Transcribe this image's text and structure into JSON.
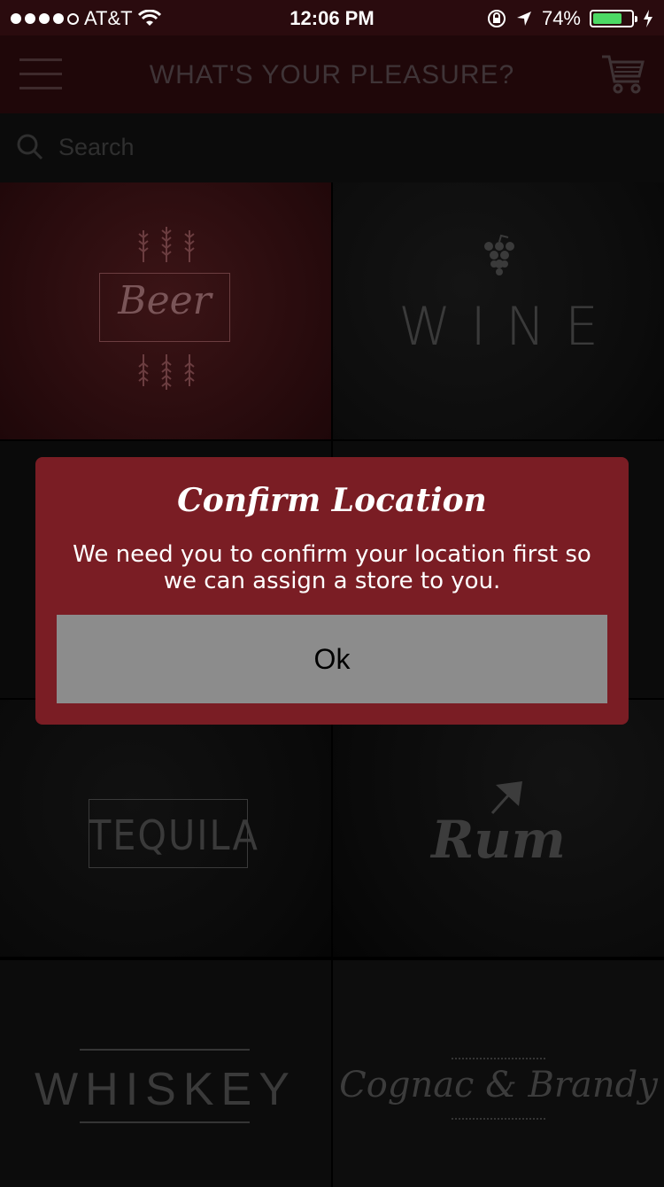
{
  "status_bar": {
    "carrier": "AT&T",
    "time": "12:06 PM",
    "battery_percent": "74%",
    "battery_level": 0.74,
    "icons": [
      "signal-dots",
      "wifi-icon",
      "lock-rotation-icon",
      "location-arrow-icon",
      "battery-icon",
      "charging-bolt-icon"
    ]
  },
  "header": {
    "title": "WHAT'S YOUR PLEASURE?",
    "menu_icon": "hamburger-menu-icon",
    "cart_icon": "shopping-cart-icon"
  },
  "search": {
    "placeholder": "Search"
  },
  "categories": [
    {
      "label": "Beer"
    },
    {
      "label": "WINE"
    },
    {
      "label": "TEQUILA"
    },
    {
      "label": "Rum"
    },
    {
      "label": "WHISKEY"
    },
    {
      "label": "Cognac & Brandy"
    }
  ],
  "modal": {
    "title": "Confirm Location",
    "message": "We need you to confirm your location first so we can assign a store to you.",
    "button_label": "Ok"
  },
  "colors": {
    "modal_bg": "#7a1d24",
    "button_bg": "#8c8c8c",
    "battery_fill": "#4cd964"
  }
}
